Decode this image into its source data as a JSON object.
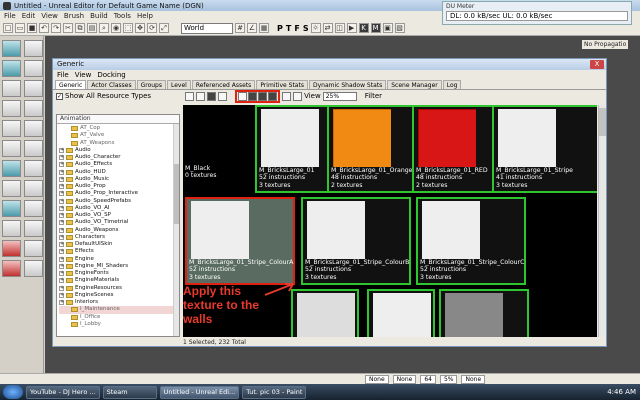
{
  "window": {
    "title": "Untitled - Unreal Editor for Default Game Name (DGN)"
  },
  "menu": [
    "File",
    "Edit",
    "View",
    "Brush",
    "Build",
    "Tools",
    "Help"
  ],
  "toolbar": {
    "world_select": "World",
    "letters": [
      "P",
      "T",
      "F",
      "S"
    ]
  },
  "du_meter": {
    "title": "DU Meter",
    "readout": "DL: 0.0 kB/sec   UL: 0.0 kB/sec"
  },
  "propagation_label": "No Propagatio",
  "generic": {
    "title": "Generic",
    "menu": [
      "File",
      "View",
      "Docking"
    ],
    "close": "X",
    "tabs": [
      "Generic",
      "Actor Classes",
      "Groups",
      "Level",
      "Referenced Assets",
      "Primitive Stats",
      "Dynamic Shadow Stats",
      "Scene Manager",
      "Log"
    ],
    "show_all_label": "Show All Resource Types",
    "view_label": "View",
    "view_value": "25%",
    "filter_label": "Filter",
    "tree_filter": "Animation",
    "status": "1 Selected, 232 Total"
  },
  "tree": [
    {
      "label": "AT_Cop",
      "sub": true
    },
    {
      "label": "AT_Valve",
      "sub": true
    },
    {
      "label": "AT_Weapons",
      "sub": true
    },
    {
      "label": "Audio"
    },
    {
      "label": "Audio_Character"
    },
    {
      "label": "Audio_Effects"
    },
    {
      "label": "Audio_HUD"
    },
    {
      "label": "Audio_Music"
    },
    {
      "label": "Audio_Prop"
    },
    {
      "label": "Audio_Prop_Interactive"
    },
    {
      "label": "Audio_SpeedPrefabs"
    },
    {
      "label": "Audio_VO_AI"
    },
    {
      "label": "Audio_VO_SP"
    },
    {
      "label": "Audio_VO_Timetrial"
    },
    {
      "label": "Audio_Weapons"
    },
    {
      "label": "Characters"
    },
    {
      "label": "DefaultUISkin"
    },
    {
      "label": "Effects"
    },
    {
      "label": "Engine"
    },
    {
      "label": "Engine_MI_Shaders"
    },
    {
      "label": "EngineFonts"
    },
    {
      "label": "EngineMaterials"
    },
    {
      "label": "EngineResources"
    },
    {
      "label": "EngineScenes"
    },
    {
      "label": "Interiors"
    },
    {
      "label": "I_Maintenance",
      "sub": true,
      "sel": true
    },
    {
      "label": "I_Office",
      "sub": true
    },
    {
      "label": "I_Lobby",
      "sub": true
    }
  ],
  "thumbs": [
    {
      "name": "M_Black",
      "line2": "0 textures",
      "line3": "",
      "style": "black",
      "sel": false
    },
    {
      "name": "M_BricksLarge_01",
      "line2": "52 instructions",
      "line3": "3 textures",
      "style": "white",
      "sel": false
    },
    {
      "name": "M_BricksLarge_01_Orange",
      "line2": "48 instructions",
      "line3": "2 textures",
      "style": "orange",
      "sel": false
    },
    {
      "name": "M_BricksLarge_01_RED",
      "line2": "48 instructions",
      "line3": "2 textures",
      "style": "red",
      "sel": false
    },
    {
      "name": "M_BricksLarge_01_Stripe",
      "line2": "41 instructions",
      "line3": "3 textures",
      "style": "white",
      "sel": false
    },
    {
      "name": "M_BricksLarge_01_Stripe_ColourA",
      "line2": "52 instructions",
      "line3": "3 textures",
      "style": "white",
      "sel": true
    },
    {
      "name": "M_BricksLarge_01_Stripe_ColourB",
      "line2": "52 instructions",
      "line3": "3 textures",
      "style": "white",
      "sel": false
    },
    {
      "name": "M_BricksLarge_01_Stripe_ColourC",
      "line2": "52 instructions",
      "line3": "3 textures",
      "style": "white",
      "sel": false
    }
  ],
  "annotation": [
    "Apply this",
    "texture to the",
    "walls"
  ],
  "statusbar": [
    "None",
    "None",
    "64",
    "5%",
    "None"
  ],
  "taskbar": {
    "items": [
      "YouTube - DJ Hero ...",
      "Steam",
      "Untitled - Unreal Edi...",
      "Tut. pic 03 - Paint"
    ],
    "clock": "4:46 AM"
  },
  "colors": {
    "accent_red": "#d21",
    "selection_green": "#2ec52e"
  }
}
